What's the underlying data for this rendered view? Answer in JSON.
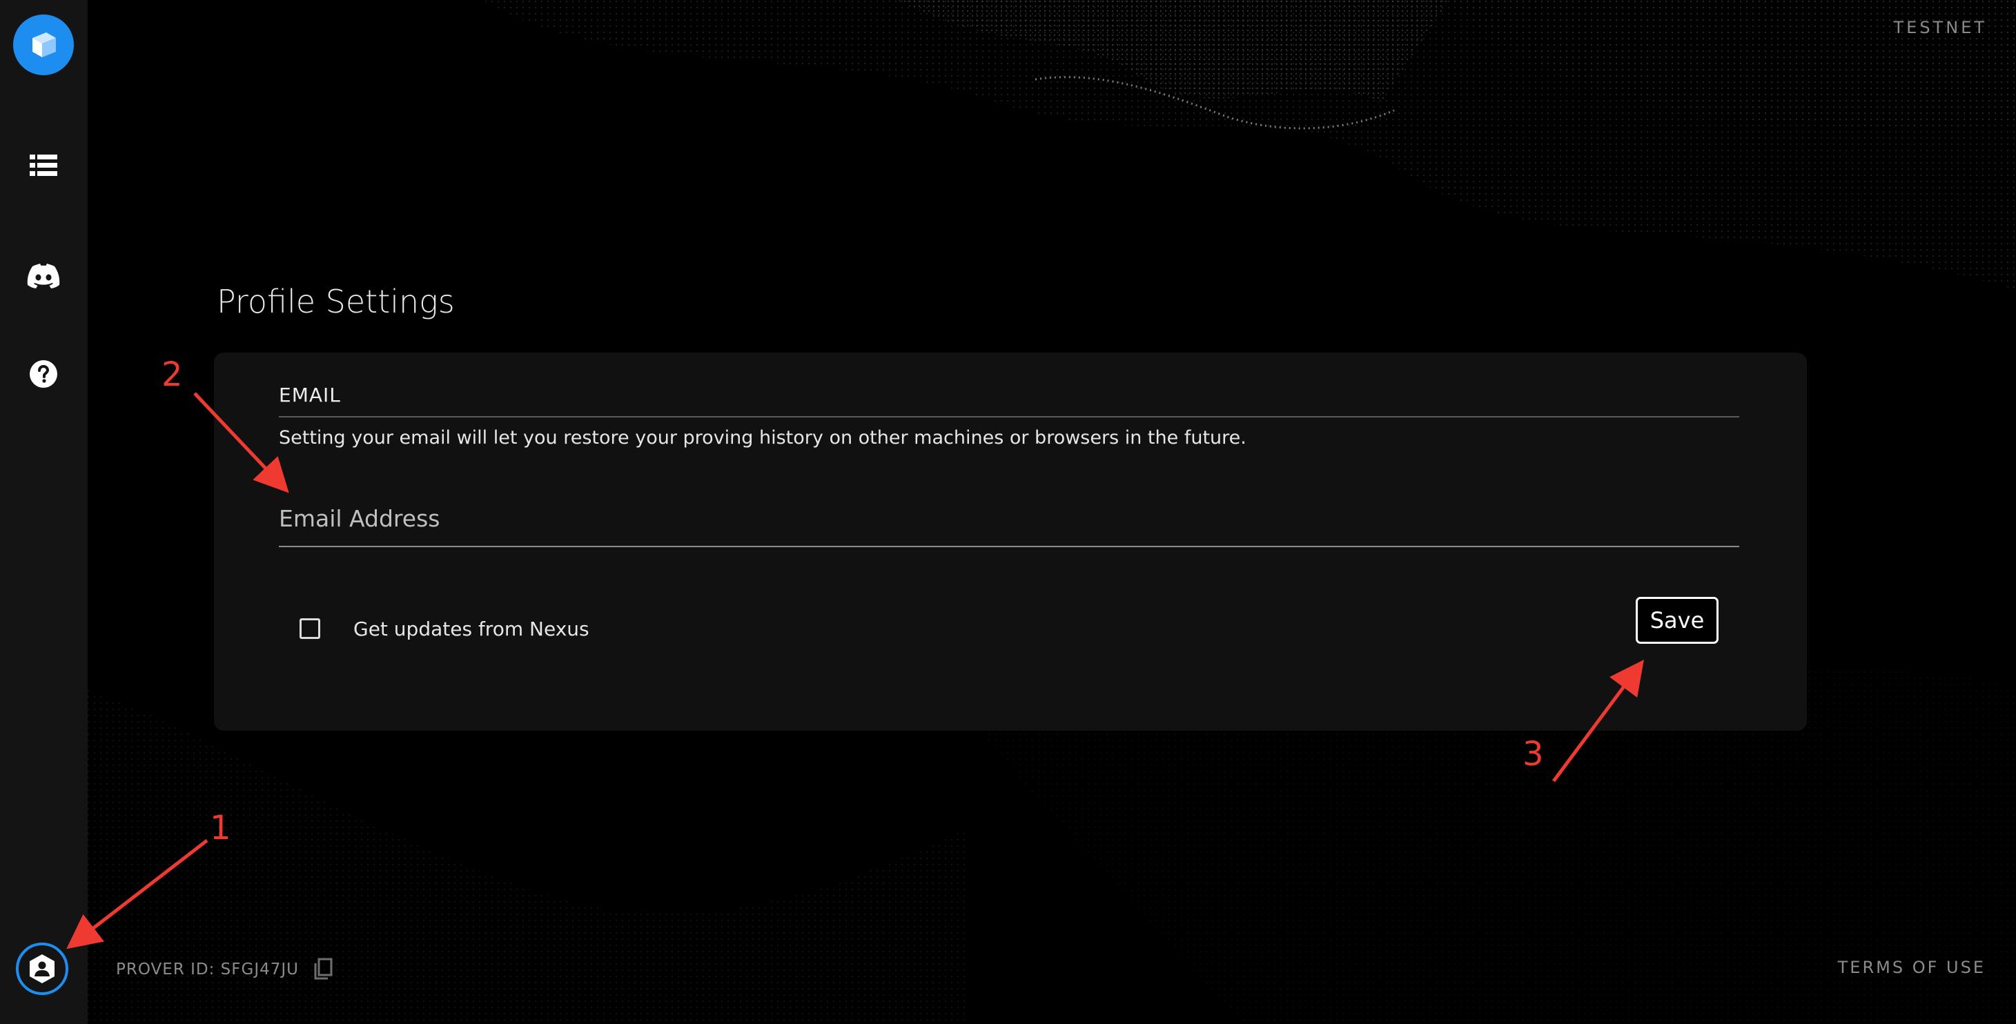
{
  "header": {
    "network_label": "TESTNET"
  },
  "sidebar": {
    "items": [
      {
        "name": "nexus-logo-icon"
      },
      {
        "name": "list-icon"
      },
      {
        "name": "discord-icon"
      },
      {
        "name": "help-icon"
      },
      {
        "name": "profile-settings-icon"
      }
    ]
  },
  "main": {
    "title": "Profile Settings",
    "card": {
      "section_label": "EMAIL",
      "description": "Setting your email will let you restore your proving history on other machines or browsers in the future.",
      "email_input": {
        "placeholder": "Email Address",
        "value": ""
      },
      "checkbox": {
        "label": "Get updates from Nexus",
        "checked": false
      },
      "save_label": "Save"
    }
  },
  "footer": {
    "prover_id": "PROVER ID: SFGJ47JU",
    "terms_label": "TERMS OF USE"
  },
  "annotations": {
    "labels": [
      "1",
      "2",
      "3"
    ]
  },
  "colors": {
    "accent": "#1d8ef0",
    "annotation": "#ee3a30",
    "card_bg": "#111111",
    "sidebar_bg": "#141414"
  }
}
